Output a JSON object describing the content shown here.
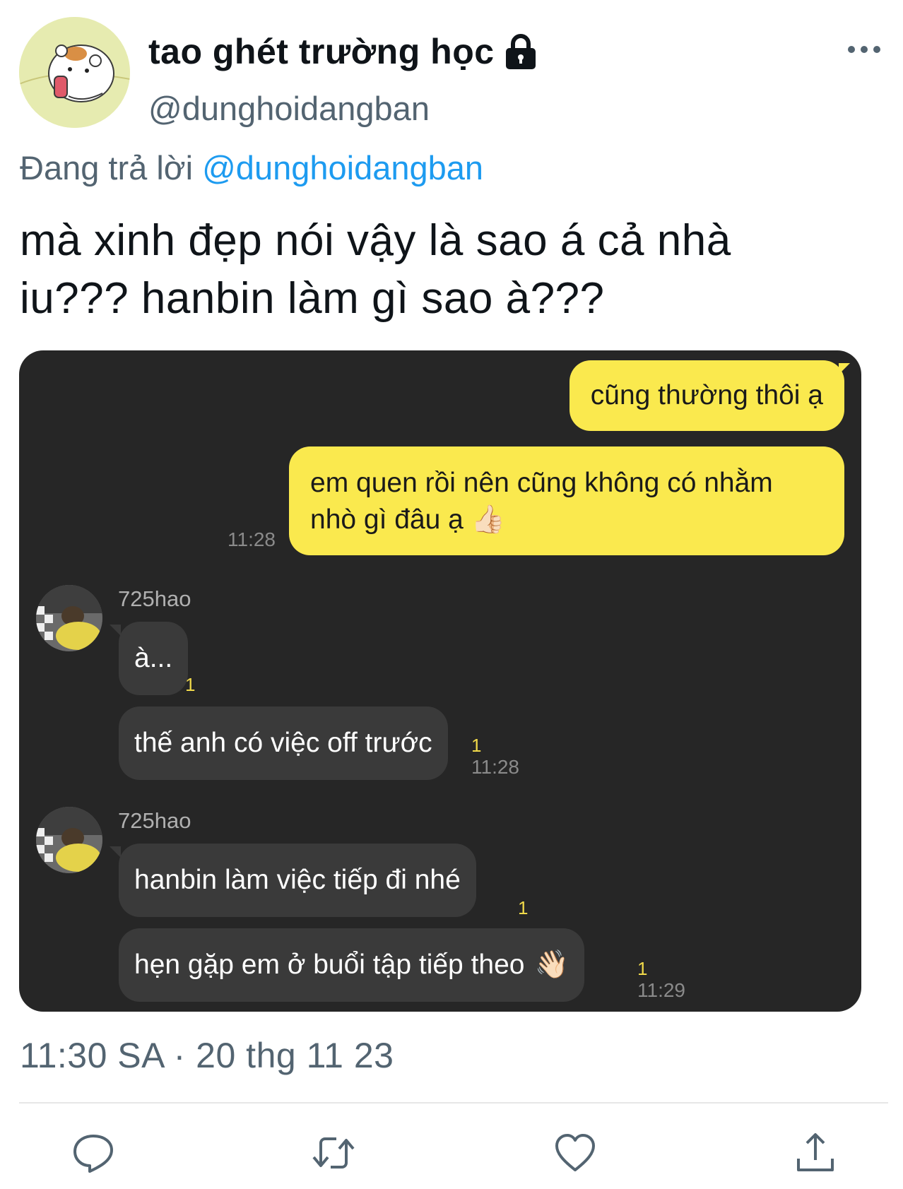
{
  "tweet": {
    "display_name": "tao ghét trường học",
    "handle": "@dunghoidangban",
    "replying_prefix": "Đang trả lời",
    "replying_to": "@dunghoidangban",
    "text_line1": "mà xinh đẹp nói vậy là sao á cả nhà",
    "text_line2": "iu??? hanbin làm gì sao à???",
    "timestamp": "11:30 SA · 20 thg 11 23"
  },
  "chat": {
    "me_messages": [
      {
        "text": "cũng thường thôi ạ"
      },
      {
        "text_line1": "em quen rồi nên cũng không có nhằm",
        "text_line2": "nhò gì đâu ạ",
        "emoji": "👍🏻",
        "time": "11:28"
      }
    ],
    "groups": [
      {
        "sender": "725hao",
        "messages": [
          {
            "text": "à...",
            "unread": "1"
          },
          {
            "text": "thế anh có việc off trước",
            "unread": "1",
            "time": "11:28"
          }
        ]
      },
      {
        "sender": "725hao",
        "messages": [
          {
            "text": "hanbin làm việc tiếp đi nhé",
            "unread": "1"
          },
          {
            "text": "hẹn gặp em ở buổi tập tiếp theo",
            "emoji": "👋🏻",
            "unread": "1",
            "time": "11:29"
          }
        ]
      }
    ]
  },
  "icons": {
    "more": "more-icon",
    "lock": "lock-icon",
    "reply": "reply-icon",
    "retweet": "retweet-icon",
    "like": "like-icon",
    "share": "share-icon"
  },
  "colors": {
    "chat_bg": "#262626",
    "my_bubble": "#fae94e",
    "other_bubble": "#3a3a3a",
    "mention": "#1d9bf0",
    "secondary_text": "#536471"
  }
}
